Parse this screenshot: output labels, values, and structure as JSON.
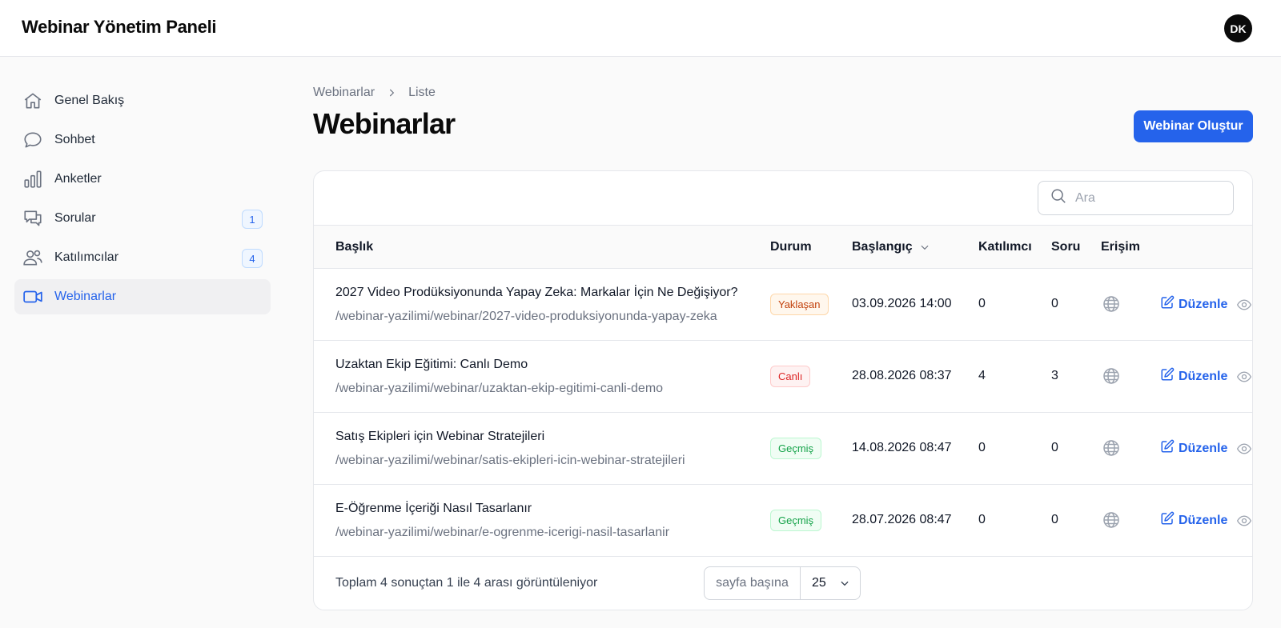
{
  "app": {
    "title": "Webinar Yönetim Paneli",
    "avatar_initials": "DK"
  },
  "sidebar": {
    "items": [
      {
        "label": "Genel Bakış",
        "icon": "home-icon",
        "badge": null,
        "active": false
      },
      {
        "label": "Sohbet",
        "icon": "chat-bubble-icon",
        "badge": null,
        "active": false
      },
      {
        "label": "Anketler",
        "icon": "bar-chart-icon",
        "badge": null,
        "active": false
      },
      {
        "label": "Sorular",
        "icon": "messages-icon",
        "badge": "1",
        "active": false
      },
      {
        "label": "Katılımcılar",
        "icon": "users-icon",
        "badge": "4",
        "active": false
      },
      {
        "label": "Webinarlar",
        "icon": "video-camera-icon",
        "badge": null,
        "active": true
      }
    ]
  },
  "breadcrumb": {
    "root": "Webinarlar",
    "current": "Liste"
  },
  "page": {
    "title": "Webinarlar",
    "create_button": "Webinar Oluştur"
  },
  "search": {
    "placeholder": "Ara",
    "value": ""
  },
  "table": {
    "columns": {
      "title": "Başlık",
      "status": "Durum",
      "start": "Başlangıç",
      "participants": "Katılımcı",
      "questions": "Soru",
      "access": "Erişim"
    },
    "sort": {
      "column": "start",
      "direction": "desc"
    },
    "edit_label": "Düzenle",
    "rows": [
      {
        "title": "2027 Video Prodüksiyonunda Yapay Zeka: Markalar İçin Ne Değişiyor?",
        "slug": "/webinar-yazilimi/webinar/2027-video-produksiyonunda-yapay-zeka",
        "status": "Yaklaşan",
        "status_kind": "upcoming",
        "start": "03.09.2026 14:00",
        "participants": "0",
        "questions": "0",
        "access": "globe-icon"
      },
      {
        "title": "Uzaktan Ekip Eğitimi: Canlı Demo",
        "slug": "/webinar-yazilimi/webinar/uzaktan-ekip-egitimi-canli-demo",
        "status": "Canlı",
        "status_kind": "live",
        "start": "28.08.2026 08:37",
        "participants": "4",
        "questions": "3",
        "access": "globe-icon"
      },
      {
        "title": "Satış Ekipleri için Webinar Stratejileri",
        "slug": "/webinar-yazilimi/webinar/satis-ekipleri-icin-webinar-stratejileri",
        "status": "Geçmiş",
        "status_kind": "past",
        "start": "14.08.2026 08:47",
        "participants": "0",
        "questions": "0",
        "access": "globe-icon"
      },
      {
        "title": "E-Öğrenme İçeriği Nasıl Tasarlanır",
        "slug": "/webinar-yazilimi/webinar/e-ogrenme-icerigi-nasil-tasarlanir",
        "status": "Geçmiş",
        "status_kind": "past",
        "start": "28.07.2026 08:47",
        "participants": "0",
        "questions": "0",
        "access": "globe-icon"
      }
    ]
  },
  "footer": {
    "summary": "Toplam 4 sonuçtan 1 ile 4 arası görüntüleniyor",
    "per_page_label": "sayfa başına",
    "per_page_value": "25"
  },
  "colors": {
    "accent": "#2563eb",
    "upcoming": {
      "text": "#c2410c",
      "bg": "#fff7ed",
      "border": "#fed7aa"
    },
    "live": {
      "text": "#dc2626",
      "bg": "#fef2f2",
      "border": "#fecaca"
    },
    "past": {
      "text": "#16a34a",
      "bg": "#f0fdf4",
      "border": "#bbf7d0"
    }
  }
}
